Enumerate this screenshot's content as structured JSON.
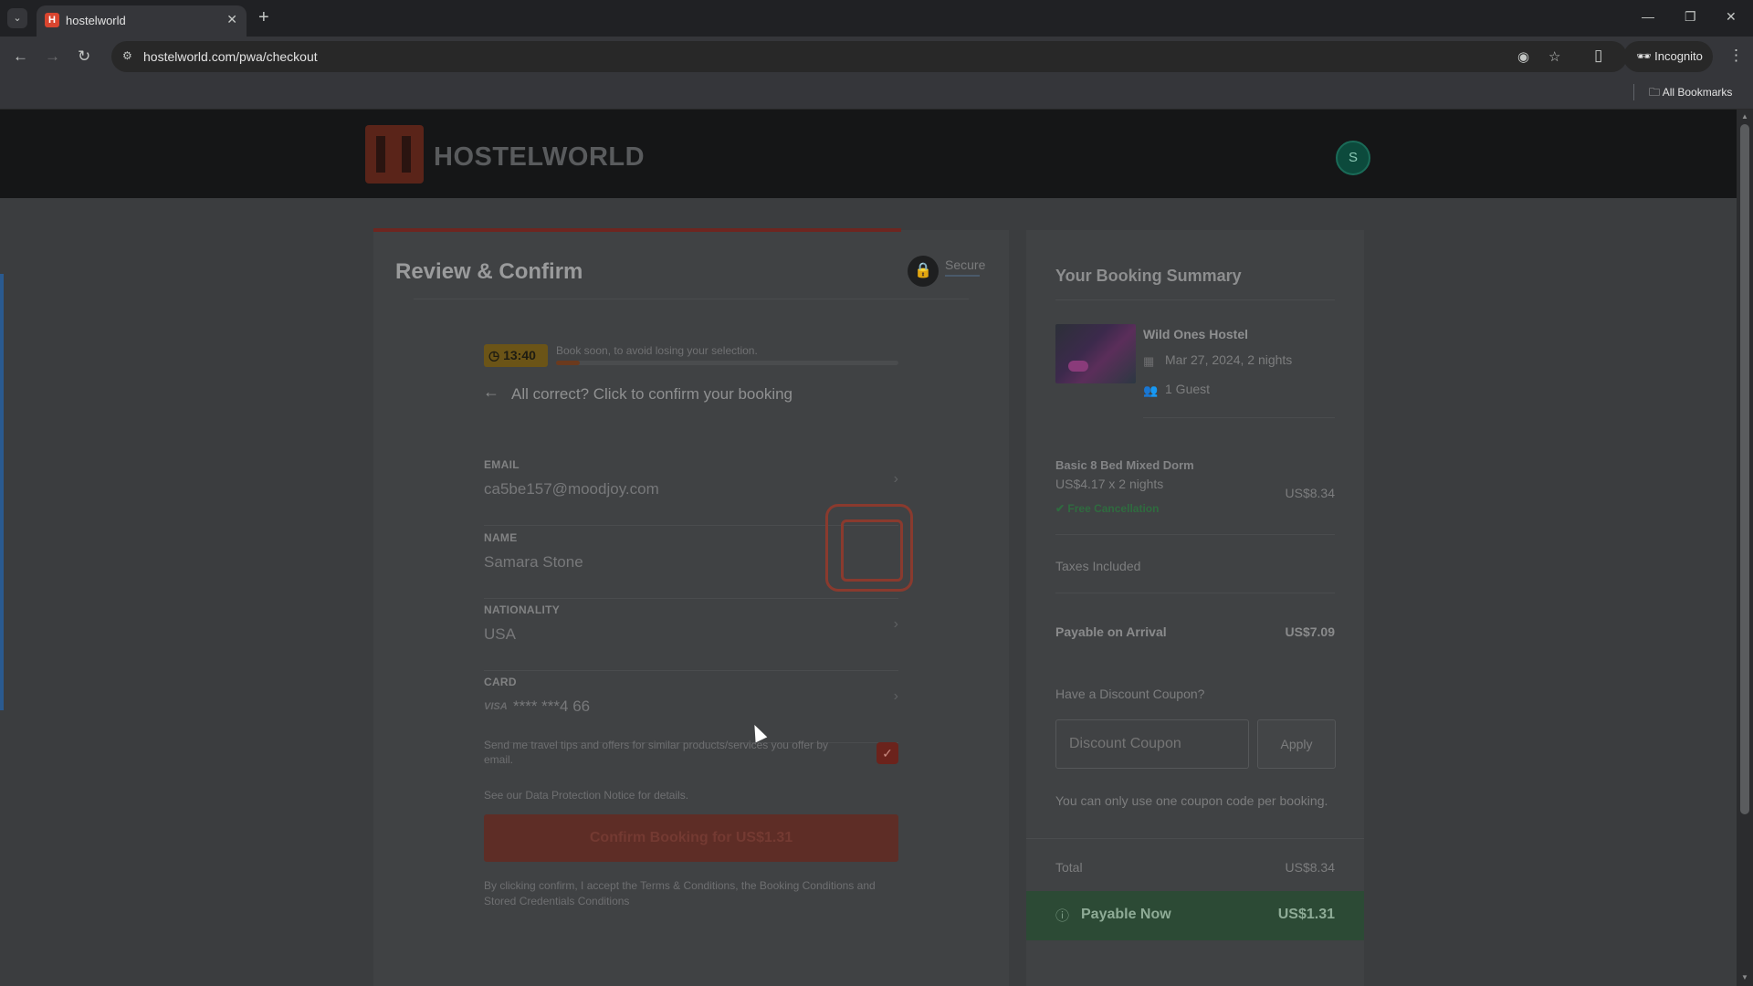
{
  "browser": {
    "tab_title": "hostelworld",
    "url": "hostelworld.com/pwa/checkout",
    "profile_label": "Incognito",
    "bookmarks_label": "All Bookmarks"
  },
  "header": {
    "logo_text": "HOSTELWORLD",
    "avatar_initial": "S"
  },
  "review": {
    "title": "Review & Confirm",
    "secure_label": "Secure",
    "timer": "13:40",
    "timer_message": "Book soon, to avoid losing your selection.",
    "timer_progress": 0.07,
    "confirm_prompt": "All correct? Click to confirm your booking",
    "fields": {
      "email_label": "EMAIL",
      "email_value": "ca5be157@moodjoy.com",
      "name_label": "NAME",
      "name_value": "Samara Stone",
      "nationality_label": "NATIONALITY",
      "nationality_value": "USA",
      "card_label": "CARD",
      "card_brand": "VISA",
      "card_value": "**** ***4 66"
    },
    "optin_text": "Send me travel tips and offers for similar products/services you offer by email.",
    "optin_checked": true,
    "data_protection": "See our Data Protection Notice for details.",
    "confirm_button": "Confirm Booking for US$1.31",
    "terms": "By clicking confirm, I accept the Terms & Conditions, the Booking Conditions and Stored Credentials Conditions"
  },
  "summary": {
    "title": "Your Booking Summary",
    "hostel_name": "Wild Ones Hostel",
    "stay": "Mar 27, 2024, 2 nights",
    "guests": "1 Guest",
    "room_name": "Basic 8 Bed Mixed Dorm",
    "room_price": "US$4.17 x 2 nights",
    "room_total": "US$8.34",
    "free_cancellation": "Free Cancellation",
    "taxes": "Taxes Included",
    "arrival_label": "Payable on Arrival",
    "arrival_value": "US$7.09",
    "coupon_question": "Have a Discount Coupon?",
    "coupon_placeholder": "Discount Coupon",
    "apply_label": "Apply",
    "coupon_note": "You can only use one coupon code per booking.",
    "total_label": "Total",
    "total_value": "US$8.34",
    "payable_now_label": "Payable Now",
    "payable_now_value": "US$1.31"
  },
  "colors": {
    "brand_red": "#d9452f",
    "payable_green": "#2c4a35",
    "free_cancel_green": "#2f6b3f"
  }
}
